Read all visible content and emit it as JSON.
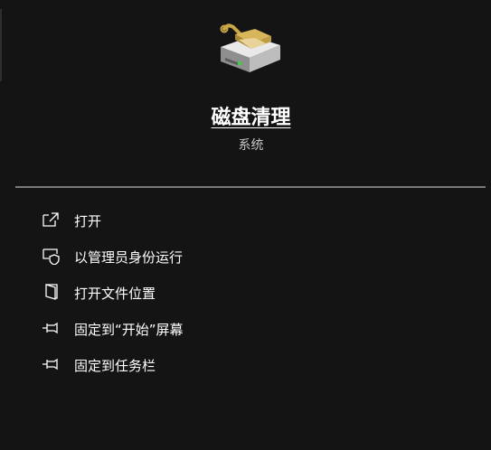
{
  "app": {
    "name": "磁盘清理",
    "category": "系统",
    "icon": "disk-cleanup-icon"
  },
  "menu": {
    "items": [
      {
        "label": "打开",
        "icon": "open-external-icon"
      },
      {
        "label": "以管理员身份运行",
        "icon": "shield-admin-icon"
      },
      {
        "label": "打开文件位置",
        "icon": "file-location-icon"
      },
      {
        "label": "固定到“开始”屏幕",
        "icon": "pin-icon"
      },
      {
        "label": "固定到任务栏",
        "icon": "pin-icon"
      }
    ]
  },
  "colors": {
    "background": "#141414",
    "divider": "#7a7a7a",
    "text": "#ffffff",
    "subtext": "#c8c8c8"
  }
}
